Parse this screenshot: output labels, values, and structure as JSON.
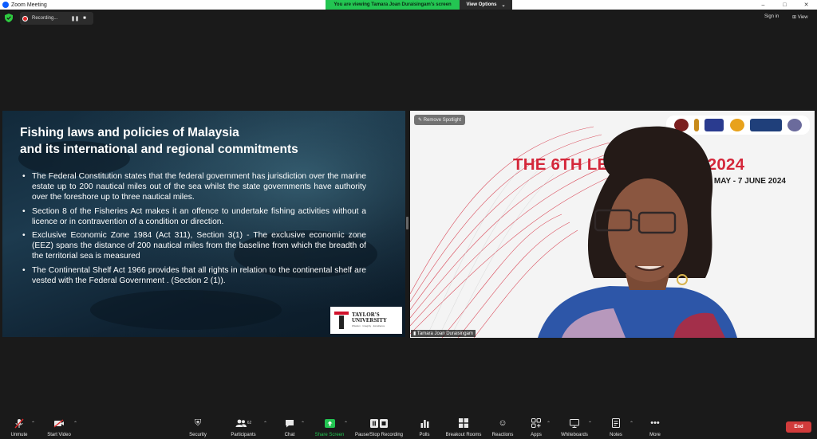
{
  "window": {
    "title": "Zoom Meeting",
    "controls": [
      "–",
      "□",
      "✕"
    ]
  },
  "banner": {
    "viewing_text": "You are viewing Tamara Joan Duraisingam's screen",
    "view_options_label": "View Options",
    "view_options_caret": "⌄"
  },
  "recording": {
    "label": "Recording...",
    "pause": "❚❚",
    "stop": "■"
  },
  "topbar": {
    "signin_label": "Sign in",
    "view_label": "View"
  },
  "slide": {
    "title_line1": "Fishing laws and policies of Malaysia",
    "title_line2": "and its international and regional commitments",
    "bullets": [
      "The Federal Constitution states that the federal government has jurisdiction over the marine estate up to 200 nautical miles out of the sea whilst the state governments have authority over the foreshore up to three nautical miles.",
      "Section 8 of the Fisheries Act makes it an offence to undertake fishing activities without a licence or in contravention of a condition or direction.",
      "Exclusive Economic Zone 1984 (Act 311), Section 3(1) - The exclusive economic zone (EEZ) spans the distance of 200 nautical miles from the baseline from which the breadth of the territorial sea is measured",
      "The Continental Shelf Act 1966 provides that all rights in relation to the continental shelf are vested with the Federal Government . (Section 2 (1))."
    ],
    "logo_name": "TAYLOR'S",
    "logo_name2": "UNIVERSITY",
    "logo_tagline": "Wisdom · Integrity · Excellence"
  },
  "speaker": {
    "remove_spotlight_label": "Remove Spotlight",
    "event_title": "THE 6TH LEX PROFICIA 2024",
    "event_dates": "27 MAY - 7 JUNE 2024",
    "name": "Tamara Joan Duraisingam",
    "logo_colors": [
      "#7a1f1f",
      "#c88a1a",
      "#2a3b8f",
      "#e8a21c",
      "#1f3f7a",
      "#6b6b9c"
    ]
  },
  "toolbar": {
    "unmute": "Unmute",
    "start_video": "Start Video",
    "security": "Security",
    "participants": "Participants",
    "participants_count": "62",
    "chat": "Chat",
    "share_screen": "Share Screen",
    "pause_recording": "Pause/Stop Recording",
    "polls": "Polls",
    "breakout_rooms": "Breakout Rooms",
    "reactions": "Reactions",
    "apps": "Apps",
    "whiteboards": "Whiteboards",
    "notes": "Notes",
    "more": "More",
    "end": "End"
  },
  "colors": {
    "share_green": "#23c552",
    "end_red": "#d13b3b",
    "event_red": "#d4273a"
  }
}
